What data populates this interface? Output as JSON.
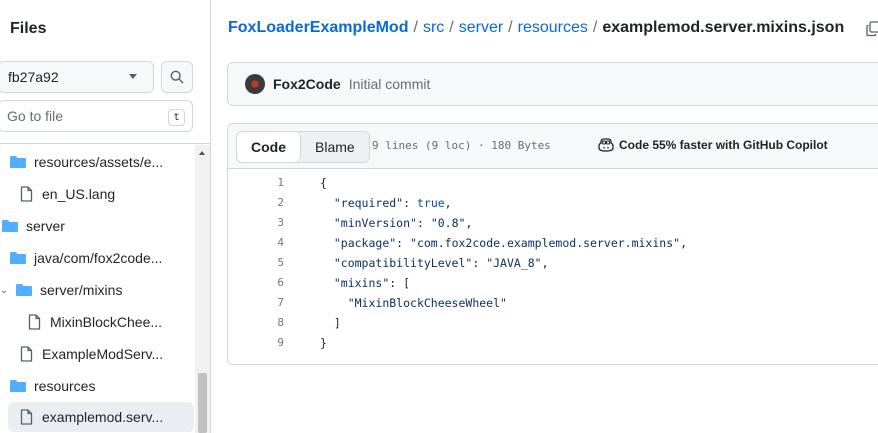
{
  "sidebar": {
    "title": "Files",
    "branch": "fb27a92",
    "goto_placeholder": "Go to file",
    "goto_shortcut": "t",
    "tree": [
      {
        "label": "resources/assets/e...",
        "type": "folder",
        "expanded": false
      },
      {
        "label": "en_US.lang",
        "type": "file"
      },
      {
        "label": "server",
        "type": "folder"
      },
      {
        "label": "java/com/fox2code...",
        "type": "folder"
      },
      {
        "label": "server/mixins",
        "type": "folder",
        "expanded": true
      },
      {
        "label": "MixinBlockChee...",
        "type": "file"
      },
      {
        "label": "ExampleModServ...",
        "type": "file"
      },
      {
        "label": "resources",
        "type": "folder"
      },
      {
        "label": "examplemod.serv...",
        "type": "file",
        "selected": true
      }
    ]
  },
  "breadcrumb": {
    "repo": "FoxLoaderExampleMod",
    "parts": [
      "src",
      "server",
      "resources"
    ],
    "current": "examplemod.server.mixins.json"
  },
  "commit": {
    "author": "Fox2Code",
    "message": "Initial commit"
  },
  "file": {
    "tabs": [
      "Code",
      "Blame"
    ],
    "active_tab": "Code",
    "meta": "9 lines (9 loc) · 180 Bytes",
    "copilot": "Code 55% faster with GitHub Copilot",
    "lines": [
      {
        "n": "1",
        "text": "{"
      },
      {
        "n": "2",
        "text": "  \"required\": true,"
      },
      {
        "n": "3",
        "text": "  \"minVersion\": \"0.8\","
      },
      {
        "n": "4",
        "text": "  \"package\": \"com.fox2code.examplemod.server.mixins\","
      },
      {
        "n": "5",
        "text": "  \"compatibilityLevel\": \"JAVA_8\","
      },
      {
        "n": "6",
        "text": "  \"mixins\": ["
      },
      {
        "n": "7",
        "text": "    \"MixinBlockCheeseWheel\""
      },
      {
        "n": "8",
        "text": "  ]"
      },
      {
        "n": "9",
        "text": "}"
      }
    ]
  },
  "colors": {
    "link": "#0969da",
    "border": "#d0d7de",
    "code_string": "#0a3069",
    "code_literal": "#0550ae",
    "folder_icon": "#54aeff"
  }
}
